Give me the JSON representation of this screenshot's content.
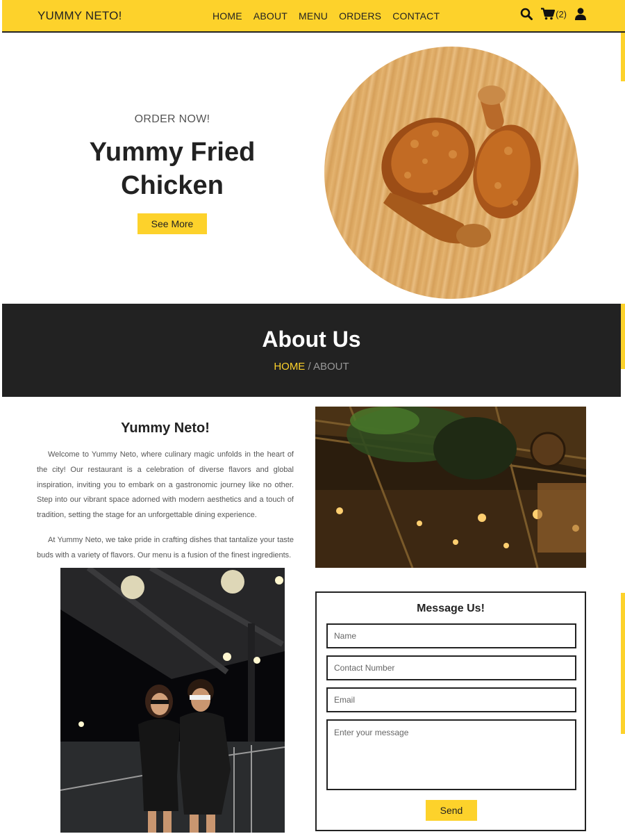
{
  "nav": {
    "brand": "YUMMY NETO!",
    "links": [
      "HOME",
      "ABOUT",
      "MENU",
      "ORDERS",
      "CONTACT"
    ],
    "cart_count": "(2)",
    "icons": [
      "search-icon",
      "cart-icon",
      "user-icon"
    ]
  },
  "hero": {
    "kicker": "ORDER NOW!",
    "title_line1": "Yummy Fried",
    "title_line2": "Chicken",
    "button": "See More"
  },
  "banner": {
    "title": "About Us",
    "crumb_home": "HOME",
    "crumb_sep": " / ",
    "crumb_current": "ABOUT"
  },
  "about": {
    "heading": "Yummy Neto!",
    "p1": "Welcome to Yummy Neto, where culinary magic unfolds in the heart of the city! Our restaurant is a celebration of diverse flavors and global inspiration, inviting you to embark on a gastronomic journey like no other. Step into our vibrant space adorned with modern aesthetics and a touch of tradition, setting the stage for an unforgettable dining experience.",
    "p2": "At Yummy Neto, we take pride in crafting dishes that tantalize your taste buds with a variety of flavors. Our menu is a fusion of the finest ingredients."
  },
  "form": {
    "title": "Message Us!",
    "name_placeholder": "Name",
    "contact_placeholder": "Contact Number",
    "email_placeholder": "Email",
    "message_placeholder": "Enter your message",
    "send": "Send"
  },
  "colors": {
    "accent": "#fdd22b",
    "dark": "#222222"
  }
}
